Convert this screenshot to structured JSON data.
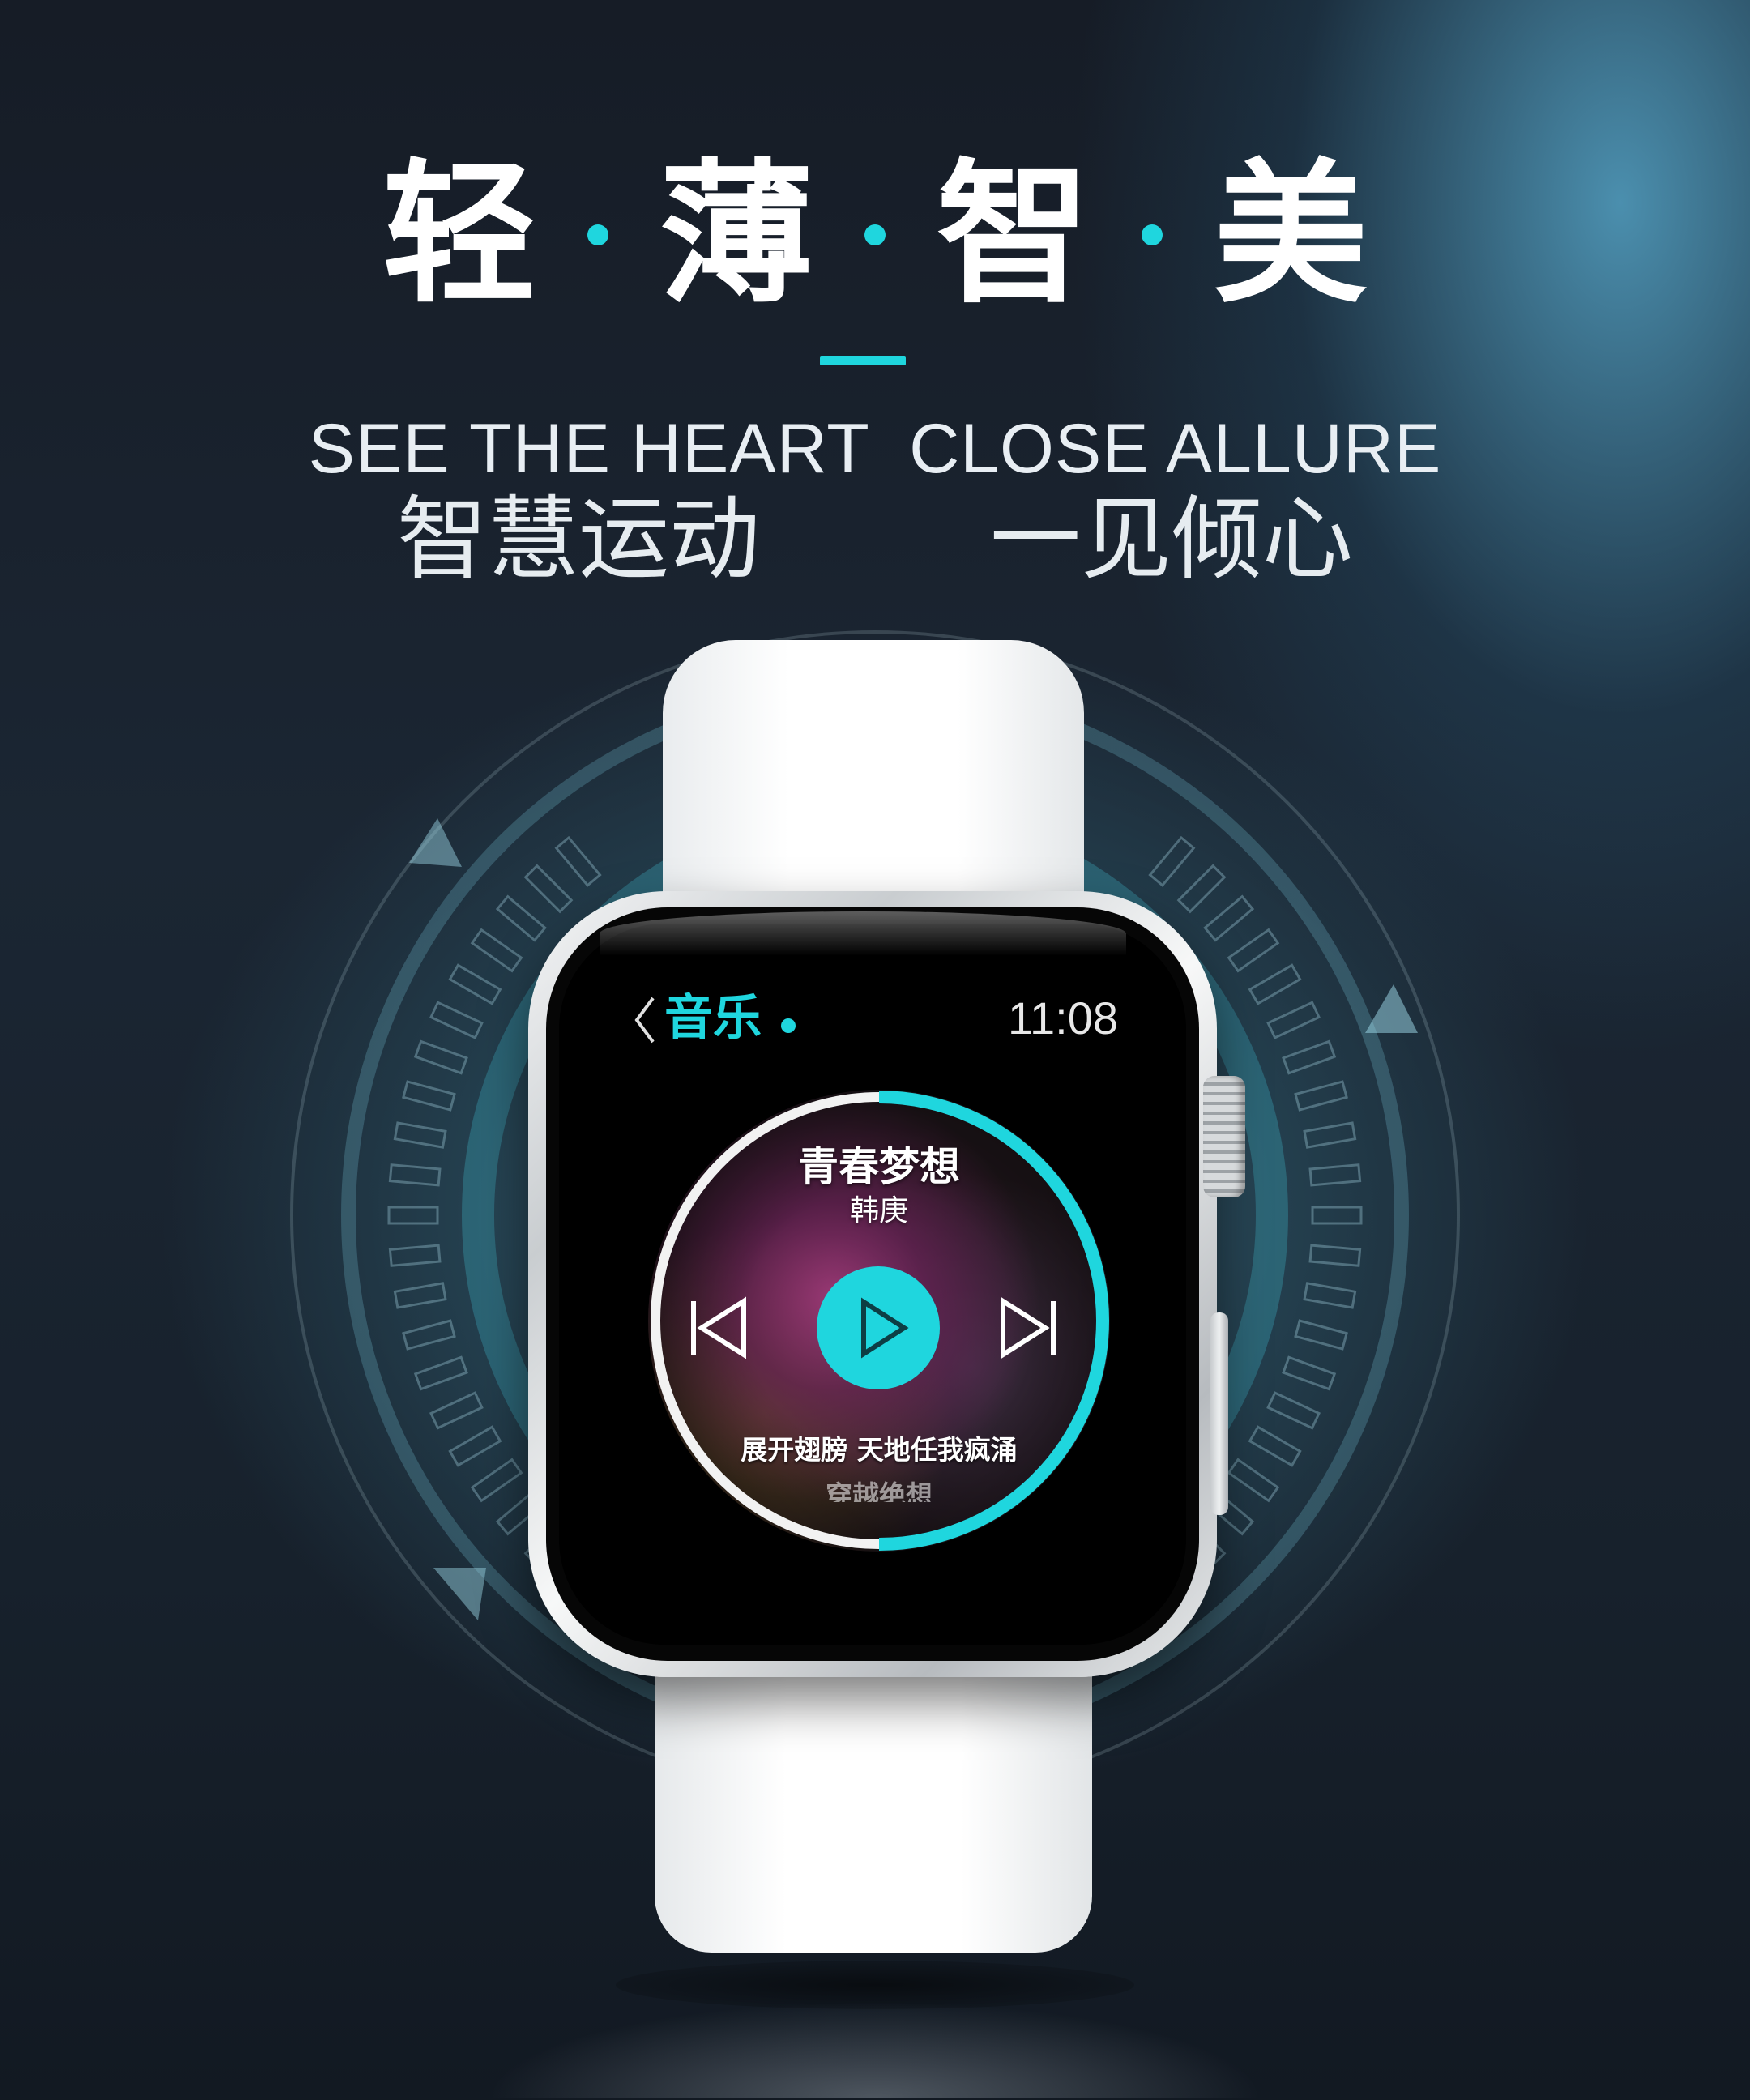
{
  "headline": {
    "chars": [
      "轻",
      "薄",
      "智",
      "美"
    ]
  },
  "tagline": {
    "english": "SEE THE HEART  CLOSE ALLURE",
    "chinese_left": "智慧运动",
    "chinese_right": "一见倾心"
  },
  "watch": {
    "app_title": "音乐",
    "time": "11:08",
    "player": {
      "song_title": "青春梦想",
      "artist": "韩庚",
      "lyric_current": "展开翅膀 天地任我疯涌",
      "lyric_next": "穿越绝想",
      "progress": 0.5
    },
    "icons": {
      "back": "chevron-left-icon",
      "previous": "skip-previous-icon",
      "play": "play-icon",
      "next": "skip-next-icon"
    }
  },
  "colors": {
    "accent": "#1fd6de",
    "background": "#1b2633",
    "band": "#ffffff"
  }
}
